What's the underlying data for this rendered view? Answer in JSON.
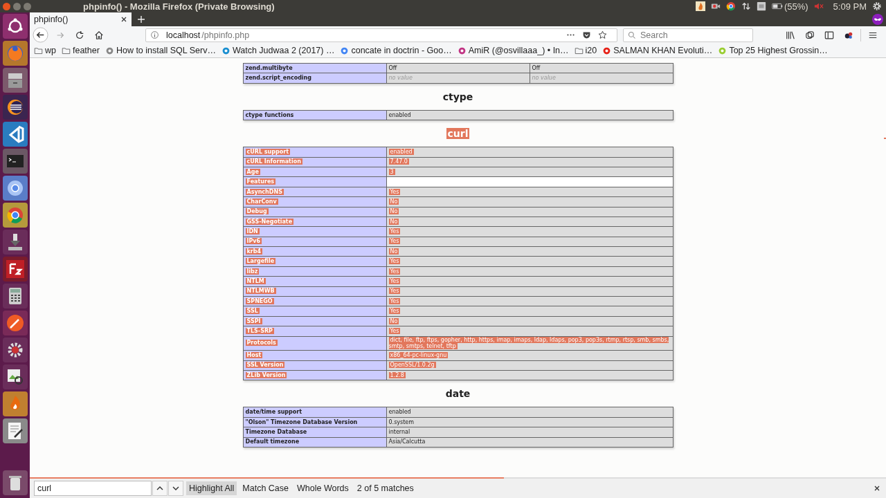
{
  "window": {
    "title": "phpinfo() - Mozilla Firefox (Private Browsing)"
  },
  "system_tray": {
    "battery": "(55%)",
    "clock": "5:09 PM"
  },
  "tabs": [
    {
      "label": "phpinfo()",
      "selected": true
    }
  ],
  "address_bar": {
    "host": "localhost",
    "path": "/phpinfo.php"
  },
  "search": {
    "placeholder": "Search"
  },
  "bookmarks": [
    {
      "label": "wp",
      "kind": "folder"
    },
    {
      "label": "feather",
      "kind": "folder"
    },
    {
      "label": "How to install SQL Serv…",
      "kind": "link"
    },
    {
      "label": "Watch Judwaa 2 (2017) …",
      "kind": "link"
    },
    {
      "label": "concate in doctrin - Goo…",
      "kind": "link"
    },
    {
      "label": "AmiR (@osvillaaa_) • In…",
      "kind": "link"
    },
    {
      "label": "i20",
      "kind": "folder"
    },
    {
      "label": "SALMAN KHAN Evoluti…",
      "kind": "link"
    },
    {
      "label": "Top 25 Highest Grossin…",
      "kind": "link"
    }
  ],
  "sections": [
    {
      "highlighted": false,
      "rows": [
        {
          "label": "zend.multibyte",
          "values": [
            "Off",
            "Off"
          ]
        },
        {
          "label": "zend.script_encoding",
          "values": [
            "no value",
            "no value"
          ],
          "no_value": true
        }
      ]
    },
    {
      "title": "ctype",
      "highlighted": false,
      "rows": [
        {
          "label": "ctype functions",
          "values": [
            "enabled"
          ]
        }
      ]
    },
    {
      "title": "curl",
      "highlighted": true,
      "rows": [
        {
          "label": "cURL support",
          "values": [
            "enabled"
          ]
        },
        {
          "label": "cURL Information",
          "values": [
            "7.47.0"
          ]
        },
        {
          "label": "Age",
          "values": [
            "3"
          ]
        },
        {
          "label": "Features",
          "kind": "subheader"
        },
        {
          "label": "AsynchDNS",
          "values": [
            "Yes"
          ]
        },
        {
          "label": "CharConv",
          "values": [
            "No"
          ]
        },
        {
          "label": "Debug",
          "values": [
            "No"
          ]
        },
        {
          "label": "GSS-Negotiate",
          "values": [
            "No"
          ]
        },
        {
          "label": "IDN",
          "values": [
            "Yes"
          ]
        },
        {
          "label": "IPv6",
          "values": [
            "Yes"
          ]
        },
        {
          "label": "krb4",
          "values": [
            "No"
          ]
        },
        {
          "label": "Largefile",
          "values": [
            "Yes"
          ]
        },
        {
          "label": "libz",
          "values": [
            "Yes"
          ]
        },
        {
          "label": "NTLM",
          "values": [
            "Yes"
          ]
        },
        {
          "label": "NTLMWB",
          "values": [
            "Yes"
          ]
        },
        {
          "label": "SPNEGO",
          "values": [
            "Yes"
          ]
        },
        {
          "label": "SSL",
          "values": [
            "Yes"
          ]
        },
        {
          "label": "SSPI",
          "values": [
            "No"
          ]
        },
        {
          "label": "TLS-SRP",
          "values": [
            "Yes"
          ]
        },
        {
          "label": "Protocols",
          "values": [
            "dict, file, ftp, ftps, gopher, http, https, imap, imaps, ldap, ldaps, pop3, pop3s, rtmp, rtsp, smb, smbs, smtp, smtps, telnet, tftp"
          ]
        },
        {
          "label": "Host",
          "values": [
            "x86_64-pc-linux-gnu"
          ]
        },
        {
          "label": "SSL Version",
          "values": [
            "OpenSSL/1.0.2g"
          ]
        },
        {
          "label": "ZLib Version",
          "values": [
            "1.2.8"
          ]
        }
      ]
    },
    {
      "title": "date",
      "highlighted": false,
      "rows": [
        {
          "label": "date/time support",
          "values": [
            "enabled"
          ]
        },
        {
          "label": "\"Olson\" Timezone Database Version",
          "values": [
            "0.system"
          ]
        },
        {
          "label": "Timezone Database",
          "values": [
            "internal"
          ]
        },
        {
          "label": "Default timezone",
          "values": [
            "Asia/Calcutta"
          ]
        }
      ]
    }
  ],
  "find_bar": {
    "value": "curl",
    "options": [
      {
        "label": "Highlight All",
        "selected": true
      },
      {
        "label": "Match Case",
        "selected": false
      },
      {
        "label": "Whole Words",
        "selected": false
      }
    ],
    "status": "2 of 5 matches"
  }
}
